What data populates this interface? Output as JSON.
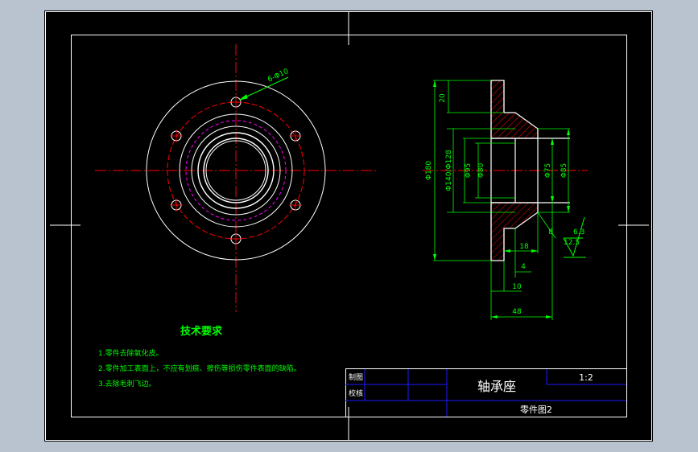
{
  "colors": {
    "background": "#b9c3cf",
    "paper": "#000000",
    "frame": "#ffffff",
    "center_line": "#ff0000",
    "dimension": "#00ff00",
    "hidden": "#ff00ff",
    "section_hatch": "#ff0000",
    "titleblock_grid": "#1a1aff"
  },
  "drawing": {
    "dimensions": {
      "hole_pattern": "6-Φ10",
      "flange_thickness": "20",
      "outer_dia": "Φ180",
      "pitch_dia": "Φ140/Φ128",
      "bore_1": "Φ95",
      "bore_2": "Φ80",
      "bore_3": "Φ75",
      "bore_4": "Φ85",
      "len_18": "18",
      "len_4": "4",
      "len_10": "10",
      "len_48": "48",
      "chamfer": "8",
      "rough_1": "6.3",
      "rough_2": "12.5"
    },
    "notes": {
      "title": "技术要求",
      "items": [
        "1.零件去除氧化皮。",
        "2.零件加工表面上，不应有划痕、擦伤等损伤零件表面的缺陷。",
        "3.去除毛刺飞边。"
      ]
    },
    "title_block": {
      "drawn_label": "制图",
      "checked_label": "校核",
      "part_name": "轴承座",
      "scale": "1:2",
      "drawing_no": "零件图2"
    }
  }
}
